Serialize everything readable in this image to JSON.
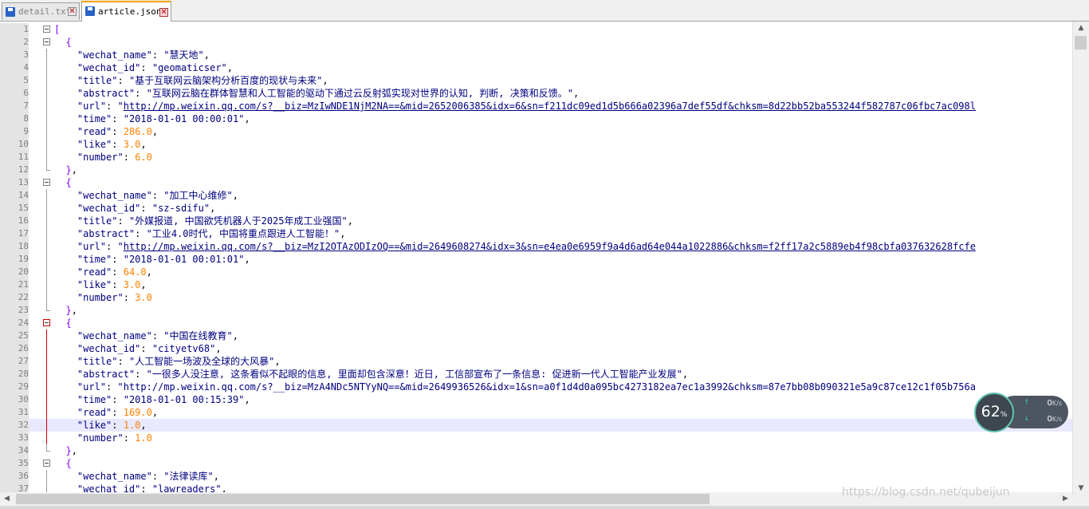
{
  "tabs": [
    {
      "label": "detail.txt",
      "close": "✕",
      "active": false
    },
    {
      "label": "article.json",
      "close": "✕",
      "active": true
    }
  ],
  "watermark": "https://blog.csdn.net/qubeijun",
  "net_widget": {
    "percent": "62",
    "unit": "%",
    "upload": "0",
    "download": "0",
    "rate_unit": "K/s"
  },
  "editor": {
    "lines": [
      {
        "n": "1",
        "fold": "box",
        "parts": [
          {
            "c": "br",
            "t": "["
          }
        ]
      },
      {
        "n": "2",
        "fold": "box",
        "parts": [
          {
            "c": "br",
            "t": "  {"
          }
        ]
      },
      {
        "n": "3",
        "fold": "line",
        "parts": [
          {
            "c": "p",
            "t": "    "
          },
          {
            "c": "k",
            "t": "\"wechat_name\""
          },
          {
            "c": "p",
            "t": ": "
          },
          {
            "c": "s",
            "t": "\"慧天地\""
          },
          {
            "c": "p",
            "t": ","
          }
        ]
      },
      {
        "n": "4",
        "fold": "line",
        "parts": [
          {
            "c": "p",
            "t": "    "
          },
          {
            "c": "k",
            "t": "\"wechat_id\""
          },
          {
            "c": "p",
            "t": ": "
          },
          {
            "c": "s",
            "t": "\"geomaticser\""
          },
          {
            "c": "p",
            "t": ","
          }
        ]
      },
      {
        "n": "5",
        "fold": "line",
        "parts": [
          {
            "c": "p",
            "t": "    "
          },
          {
            "c": "k",
            "t": "\"title\""
          },
          {
            "c": "p",
            "t": ": "
          },
          {
            "c": "s",
            "t": "\"基于互联网云脑架构分析百度的现状与未来\""
          },
          {
            "c": "p",
            "t": ","
          }
        ]
      },
      {
        "n": "6",
        "fold": "line",
        "parts": [
          {
            "c": "p",
            "t": "    "
          },
          {
            "c": "k",
            "t": "\"abstract\""
          },
          {
            "c": "p",
            "t": ": "
          },
          {
            "c": "s",
            "t": "\"互联网云脑在群体智慧和人工智能的驱动下通过云反射弧实现对世界的认知, 判断, 决策和反馈。\""
          },
          {
            "c": "p",
            "t": ","
          }
        ]
      },
      {
        "n": "7",
        "fold": "line",
        "parts": [
          {
            "c": "p",
            "t": "    "
          },
          {
            "c": "k",
            "t": "\"url\""
          },
          {
            "c": "p",
            "t": ": "
          },
          {
            "c": "s",
            "t": "\""
          },
          {
            "c": "u",
            "t": "http://mp.weixin.qq.com/s?__biz=MzIwNDE1NjM2NA==&mid=2652006385&idx=6&sn=f211dc09ed1d5b666a02396a7def55df&chksm=8d22bb52ba553244f582787c06fbc7ac098l"
          }
        ]
      },
      {
        "n": "8",
        "fold": "line",
        "parts": [
          {
            "c": "p",
            "t": "    "
          },
          {
            "c": "k",
            "t": "\"time\""
          },
          {
            "c": "p",
            "t": ": "
          },
          {
            "c": "s",
            "t": "\"2018-01-01 00:00:01\""
          },
          {
            "c": "p",
            "t": ","
          }
        ]
      },
      {
        "n": "9",
        "fold": "line",
        "parts": [
          {
            "c": "p",
            "t": "    "
          },
          {
            "c": "k",
            "t": "\"read\""
          },
          {
            "c": "p",
            "t": ": "
          },
          {
            "c": "n",
            "t": "286.0"
          },
          {
            "c": "p",
            "t": ","
          }
        ]
      },
      {
        "n": "10",
        "fold": "line",
        "parts": [
          {
            "c": "p",
            "t": "    "
          },
          {
            "c": "k",
            "t": "\"like\""
          },
          {
            "c": "p",
            "t": ": "
          },
          {
            "c": "n",
            "t": "3.0"
          },
          {
            "c": "p",
            "t": ","
          }
        ]
      },
      {
        "n": "11",
        "fold": "line",
        "parts": [
          {
            "c": "p",
            "t": "    "
          },
          {
            "c": "k",
            "t": "\"number\""
          },
          {
            "c": "p",
            "t": ": "
          },
          {
            "c": "n",
            "t": "6.0"
          }
        ]
      },
      {
        "n": "12",
        "fold": "end",
        "parts": [
          {
            "c": "br",
            "t": "  }"
          },
          {
            "c": "p",
            "t": ","
          }
        ]
      },
      {
        "n": "13",
        "fold": "box",
        "parts": [
          {
            "c": "br",
            "t": "  {"
          }
        ]
      },
      {
        "n": "14",
        "fold": "line",
        "parts": [
          {
            "c": "p",
            "t": "    "
          },
          {
            "c": "k",
            "t": "\"wechat_name\""
          },
          {
            "c": "p",
            "t": ": "
          },
          {
            "c": "s",
            "t": "\"加工中心维修\""
          },
          {
            "c": "p",
            "t": ","
          }
        ]
      },
      {
        "n": "15",
        "fold": "line",
        "parts": [
          {
            "c": "p",
            "t": "    "
          },
          {
            "c": "k",
            "t": "\"wechat_id\""
          },
          {
            "c": "p",
            "t": ": "
          },
          {
            "c": "s",
            "t": "\"sz-sdifu\""
          },
          {
            "c": "p",
            "t": ","
          }
        ]
      },
      {
        "n": "16",
        "fold": "line",
        "parts": [
          {
            "c": "p",
            "t": "    "
          },
          {
            "c": "k",
            "t": "\"title\""
          },
          {
            "c": "p",
            "t": ": "
          },
          {
            "c": "s",
            "t": "\"外媒报道, 中国欲凭机器人于2025年成工业强国\""
          },
          {
            "c": "p",
            "t": ","
          }
        ]
      },
      {
        "n": "17",
        "fold": "line",
        "parts": [
          {
            "c": "p",
            "t": "    "
          },
          {
            "c": "k",
            "t": "\"abstract\""
          },
          {
            "c": "p",
            "t": ": "
          },
          {
            "c": "s",
            "t": "\"工业4.0时代, 中国将重点跟进人工智能！\""
          },
          {
            "c": "p",
            "t": ","
          }
        ]
      },
      {
        "n": "18",
        "fold": "line",
        "parts": [
          {
            "c": "p",
            "t": "    "
          },
          {
            "c": "k",
            "t": "\"url\""
          },
          {
            "c": "p",
            "t": ": "
          },
          {
            "c": "s",
            "t": "\""
          },
          {
            "c": "u",
            "t": "http://mp.weixin.qq.com/s?__biz=MzI2OTAzODIzOQ==&mid=2649608274&idx=3&sn=e4ea0e6959f9a4d6ad64e044a1022886&chksm=f2ff17a2c5889eb4f98cbfa037632628fcfe"
          }
        ]
      },
      {
        "n": "19",
        "fold": "line",
        "parts": [
          {
            "c": "p",
            "t": "    "
          },
          {
            "c": "k",
            "t": "\"time\""
          },
          {
            "c": "p",
            "t": ": "
          },
          {
            "c": "s",
            "t": "\"2018-01-01 00:01:01\""
          },
          {
            "c": "p",
            "t": ","
          }
        ]
      },
      {
        "n": "20",
        "fold": "line",
        "parts": [
          {
            "c": "p",
            "t": "    "
          },
          {
            "c": "k",
            "t": "\"read\""
          },
          {
            "c": "p",
            "t": ": "
          },
          {
            "c": "n",
            "t": "64.0"
          },
          {
            "c": "p",
            "t": ","
          }
        ]
      },
      {
        "n": "21",
        "fold": "line",
        "parts": [
          {
            "c": "p",
            "t": "    "
          },
          {
            "c": "k",
            "t": "\"like\""
          },
          {
            "c": "p",
            "t": ": "
          },
          {
            "c": "n",
            "t": "3.0"
          },
          {
            "c": "p",
            "t": ","
          }
        ]
      },
      {
        "n": "22",
        "fold": "line",
        "parts": [
          {
            "c": "p",
            "t": "    "
          },
          {
            "c": "k",
            "t": "\"number\""
          },
          {
            "c": "p",
            "t": ": "
          },
          {
            "c": "n",
            "t": "3.0"
          }
        ]
      },
      {
        "n": "23",
        "fold": "end",
        "parts": [
          {
            "c": "br",
            "t": "  }"
          },
          {
            "c": "p",
            "t": ","
          }
        ]
      },
      {
        "n": "24",
        "fold": "box-red",
        "parts": [
          {
            "c": "br",
            "t": "  {"
          }
        ]
      },
      {
        "n": "25",
        "fold": "line-red",
        "parts": [
          {
            "c": "p",
            "t": "    "
          },
          {
            "c": "k",
            "t": "\"wechat_name\""
          },
          {
            "c": "p",
            "t": ": "
          },
          {
            "c": "s",
            "t": "\"中国在线教育\""
          },
          {
            "c": "p",
            "t": ","
          }
        ]
      },
      {
        "n": "26",
        "fold": "line-red",
        "parts": [
          {
            "c": "p",
            "t": "    "
          },
          {
            "c": "k",
            "t": "\"wechat_id\""
          },
          {
            "c": "p",
            "t": ": "
          },
          {
            "c": "s",
            "t": "\"cityetv68\""
          },
          {
            "c": "p",
            "t": ","
          }
        ]
      },
      {
        "n": "27",
        "fold": "line-red",
        "parts": [
          {
            "c": "p",
            "t": "    "
          },
          {
            "c": "k",
            "t": "\"title\""
          },
          {
            "c": "p",
            "t": ": "
          },
          {
            "c": "s",
            "t": "\"人工智能一场波及全球的大风暴\""
          },
          {
            "c": "p",
            "t": ","
          }
        ]
      },
      {
        "n": "28",
        "fold": "line-red",
        "parts": [
          {
            "c": "p",
            "t": "    "
          },
          {
            "c": "k",
            "t": "\"abstract\""
          },
          {
            "c": "p",
            "t": ": "
          },
          {
            "c": "s",
            "t": "\"一很多人没注意, 这条看似不起眼的信息, 里面却包含深意！近日, 工信部宣布了一条信息: 促进新一代人工智能产业发展\""
          },
          {
            "c": "p",
            "t": ","
          }
        ]
      },
      {
        "n": "29",
        "fold": "line-red",
        "parts": [
          {
            "c": "p",
            "t": "    "
          },
          {
            "c": "k",
            "t": "\"url\""
          },
          {
            "c": "p",
            "t": ": "
          },
          {
            "c": "s",
            "t": "\"http://mp.weixin.qq.com/s?__biz=MzA4NDc5NTYyNQ==&mid=2649936526&idx=1&sn=a0f1d4d0a095bc4273182ea7ec1a3992&chksm=87e7bb08b090321e5a9c87ce12c1f05b756a"
          }
        ]
      },
      {
        "n": "30",
        "fold": "line-red",
        "parts": [
          {
            "c": "p",
            "t": "    "
          },
          {
            "c": "k",
            "t": "\"time\""
          },
          {
            "c": "p",
            "t": ": "
          },
          {
            "c": "s",
            "t": "\"2018-01-01 00:15:39\""
          },
          {
            "c": "p",
            "t": ","
          }
        ]
      },
      {
        "n": "31",
        "fold": "line-red",
        "parts": [
          {
            "c": "p",
            "t": "    "
          },
          {
            "c": "k",
            "t": "\"read\""
          },
          {
            "c": "p",
            "t": ": "
          },
          {
            "c": "n",
            "t": "169.0"
          },
          {
            "c": "p",
            "t": ","
          }
        ]
      },
      {
        "n": "32",
        "fold": "line-red",
        "hl": true,
        "parts": [
          {
            "c": "p",
            "t": "    "
          },
          {
            "c": "k",
            "t": "\"like\""
          },
          {
            "c": "p",
            "t": ": "
          },
          {
            "c": "n",
            "t": "1.0"
          },
          {
            "c": "p",
            "t": ","
          }
        ]
      },
      {
        "n": "33",
        "fold": "line-red",
        "parts": [
          {
            "c": "p",
            "t": "    "
          },
          {
            "c": "k",
            "t": "\"number\""
          },
          {
            "c": "p",
            "t": ": "
          },
          {
            "c": "n",
            "t": "1.0"
          }
        ]
      },
      {
        "n": "34",
        "fold": "end",
        "parts": [
          {
            "c": "br",
            "t": "  }"
          },
          {
            "c": "p",
            "t": ","
          }
        ]
      },
      {
        "n": "35",
        "fold": "box",
        "parts": [
          {
            "c": "br",
            "t": "  {"
          }
        ]
      },
      {
        "n": "36",
        "fold": "line",
        "parts": [
          {
            "c": "p",
            "t": "    "
          },
          {
            "c": "k",
            "t": "\"wechat_name\""
          },
          {
            "c": "p",
            "t": ": "
          },
          {
            "c": "s",
            "t": "\"法律读库\""
          },
          {
            "c": "p",
            "t": ","
          }
        ]
      },
      {
        "n": "37",
        "fold": "line",
        "parts": [
          {
            "c": "p",
            "t": "    "
          },
          {
            "c": "k",
            "t": "\"wechat_id\""
          },
          {
            "c": "p",
            "t": ": "
          },
          {
            "c": "s",
            "t": "\"lawreaders\""
          },
          {
            "c": "p",
            "t": ","
          }
        ]
      }
    ]
  }
}
